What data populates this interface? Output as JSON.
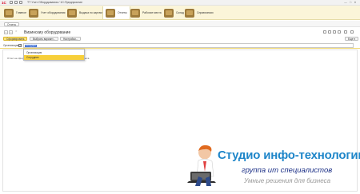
{
  "titlebar": {
    "logo": "1С",
    "title": "TT Учет Оборудования / 1С:Предприятие",
    "right_buttons": [
      "—",
      "□",
      "✕"
    ]
  },
  "sections": [
    {
      "label": "Главное",
      "icon": "home-icon"
    },
    {
      "label": "Учет оборудования",
      "icon": "equipment-icon"
    },
    {
      "label": "Выдача по картам",
      "icon": "cards-icon"
    },
    {
      "label": "Отчеты",
      "icon": "reports-icon",
      "active": true
    },
    {
      "label": "Рабочие места",
      "icon": "workplace-icon"
    },
    {
      "label": "Склад",
      "icon": "warehouse-icon"
    },
    {
      "label": "Справочники",
      "icon": "books-icon"
    }
  ],
  "subbar": {
    "tab": "Отчеты"
  },
  "form": {
    "back": "←",
    "forward": "→",
    "star": "☆",
    "title": "Визинскиу оборудование"
  },
  "toolbar": {
    "generate": "Сформировать",
    "choose_variant": "Выбрать вариант...",
    "settings": "Настройки...",
    "more": "Еще ▾"
  },
  "filter": {
    "label": "Организация:",
    "checked": "✓",
    "selected_text": "Сотрудни"
  },
  "dropdown": {
    "items": [
      "Организация",
      "Сотрудник"
    ]
  },
  "report": {
    "message": "Отчет не сформирован. Нажмите \"Сформировать\" для получения отчета."
  },
  "watermark": {
    "title": "Студио инфо-технологии",
    "subtitle": "группа ит специалистов",
    "tagline": "Умные решения для бизнеса"
  }
}
